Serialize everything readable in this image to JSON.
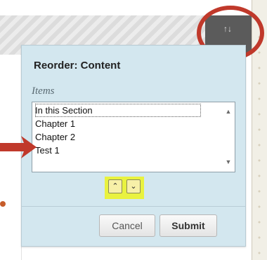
{
  "dialog": {
    "title": "Reorder: Content",
    "items_label": "Items",
    "items": [
      "In this Section",
      "Chapter 1",
      "Chapter 2",
      "Test 1"
    ],
    "selected_index": 0,
    "move_up_icon": "chevron-up-icon",
    "move_down_icon": "chevron-down-icon",
    "cancel_label": "Cancel",
    "submit_label": "Submit"
  },
  "toolbar": {
    "reorder_icon": "reorder-arrows-icon"
  },
  "annotations": {
    "color": "#c0392b",
    "highlight_color": "#e9f23f"
  }
}
